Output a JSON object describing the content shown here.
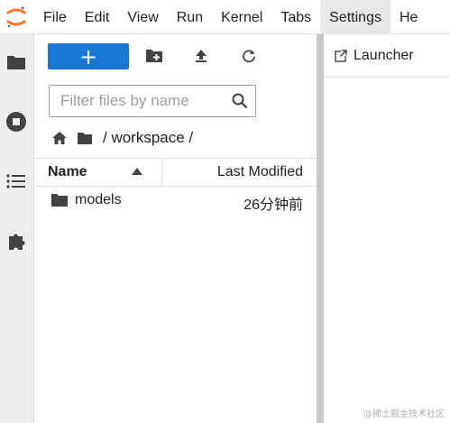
{
  "menubar": {
    "items": [
      {
        "label": "File"
      },
      {
        "label": "Edit"
      },
      {
        "label": "View"
      },
      {
        "label": "Run"
      },
      {
        "label": "Kernel"
      },
      {
        "label": "Tabs"
      },
      {
        "label": "Settings"
      },
      {
        "label": "He"
      }
    ],
    "active_item": "Settings"
  },
  "activity_bar": {
    "icons": [
      "folder-icon",
      "stop-circle-icon",
      "list-icon",
      "puzzle-icon"
    ]
  },
  "file_browser": {
    "new_button_label": "+",
    "toolbar_icons": [
      "new-folder-icon",
      "upload-icon",
      "refresh-icon"
    ],
    "filter_placeholder": "Filter files by name",
    "filter_value": "",
    "breadcrumb_path": "/ workspace /",
    "columns": {
      "name": "Name",
      "modified": "Last Modified"
    },
    "rows": [
      {
        "name": "models",
        "modified": "26分钟前",
        "icon": "folder-icon"
      }
    ]
  },
  "dock": {
    "tab_label": "Launcher"
  },
  "watermark": "@稀土掘金技术社区",
  "colors": {
    "accent": "#1976d2",
    "activity_bar_bg": "#eeeeee",
    "splitter": "#c8c8c8",
    "logo_orange": "#f37726"
  }
}
